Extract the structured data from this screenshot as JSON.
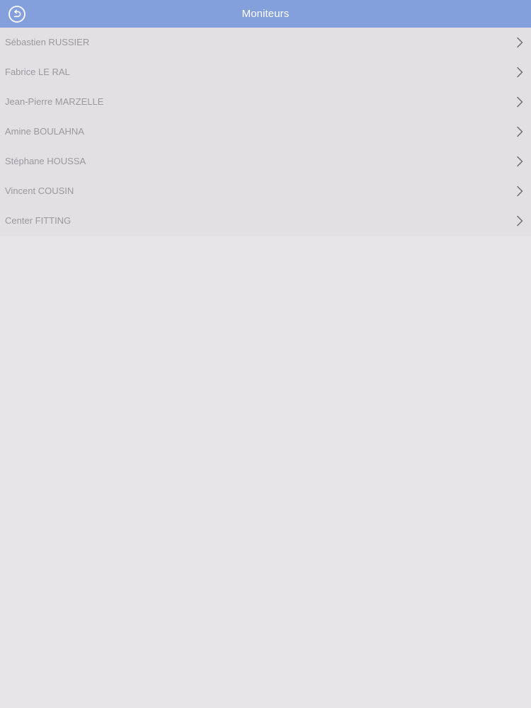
{
  "header": {
    "title": "Moniteurs",
    "back_icon": "back-arrow-circle-icon",
    "color": "#839fdc"
  },
  "list": {
    "items": [
      {
        "label": "Sébastien RUSSIER"
      },
      {
        "label": "Fabrice LE RAL"
      },
      {
        "label": "Jean-Pierre MARZELLE"
      },
      {
        "label": "Amine BOULAHNA"
      },
      {
        "label": "Stéphane HOUSSA"
      },
      {
        "label": "Vincent COUSIN"
      },
      {
        "label": "Center FITTING"
      }
    ],
    "item_icon": "chevron-right-icon"
  }
}
